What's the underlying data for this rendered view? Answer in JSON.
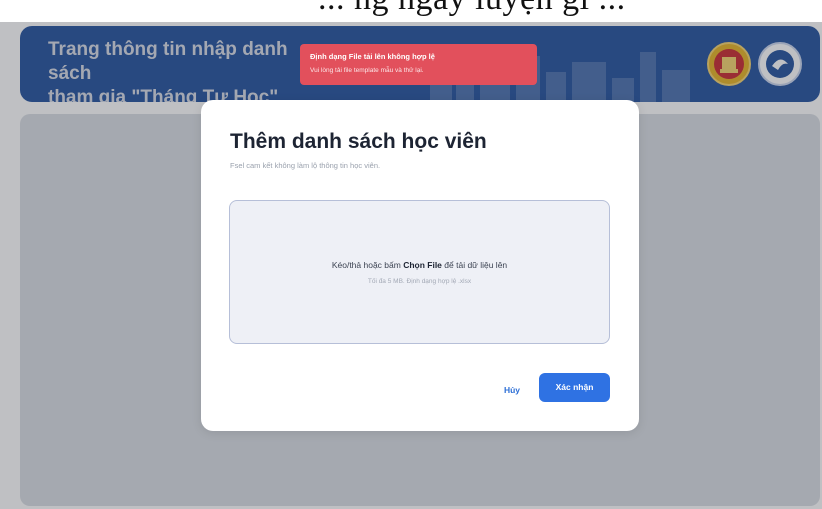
{
  "page_top_text": "... ng ngày luyện gi ...",
  "header": {
    "title_line1": "Trang thông tin nhập danh sách",
    "title_line2": "tham gia \"Tháng Tự Học\""
  },
  "toast": {
    "title": "Định dạng File tải lên không hợp lệ",
    "message": "Vui lòng tải file template mẫu và thử lại.",
    "color": "#e2505c"
  },
  "modal": {
    "title": "Thêm danh sách học viên",
    "subtitle": "Fsel cam kết không làm lộ thông tin học viên.",
    "dropzone": {
      "text_before": "Kéo/thả hoặc bấm ",
      "text_bold": "Chọn File",
      "text_after": " để tải dữ liệu lên",
      "hint": "Tối đa 5 MB. Định dạng hợp lệ .xlsx"
    },
    "cancel_label": "Hủy",
    "confirm_label": "Xác nhận"
  },
  "colors": {
    "header_bg": "#1f4e9c",
    "accent": "#2f72e3"
  }
}
